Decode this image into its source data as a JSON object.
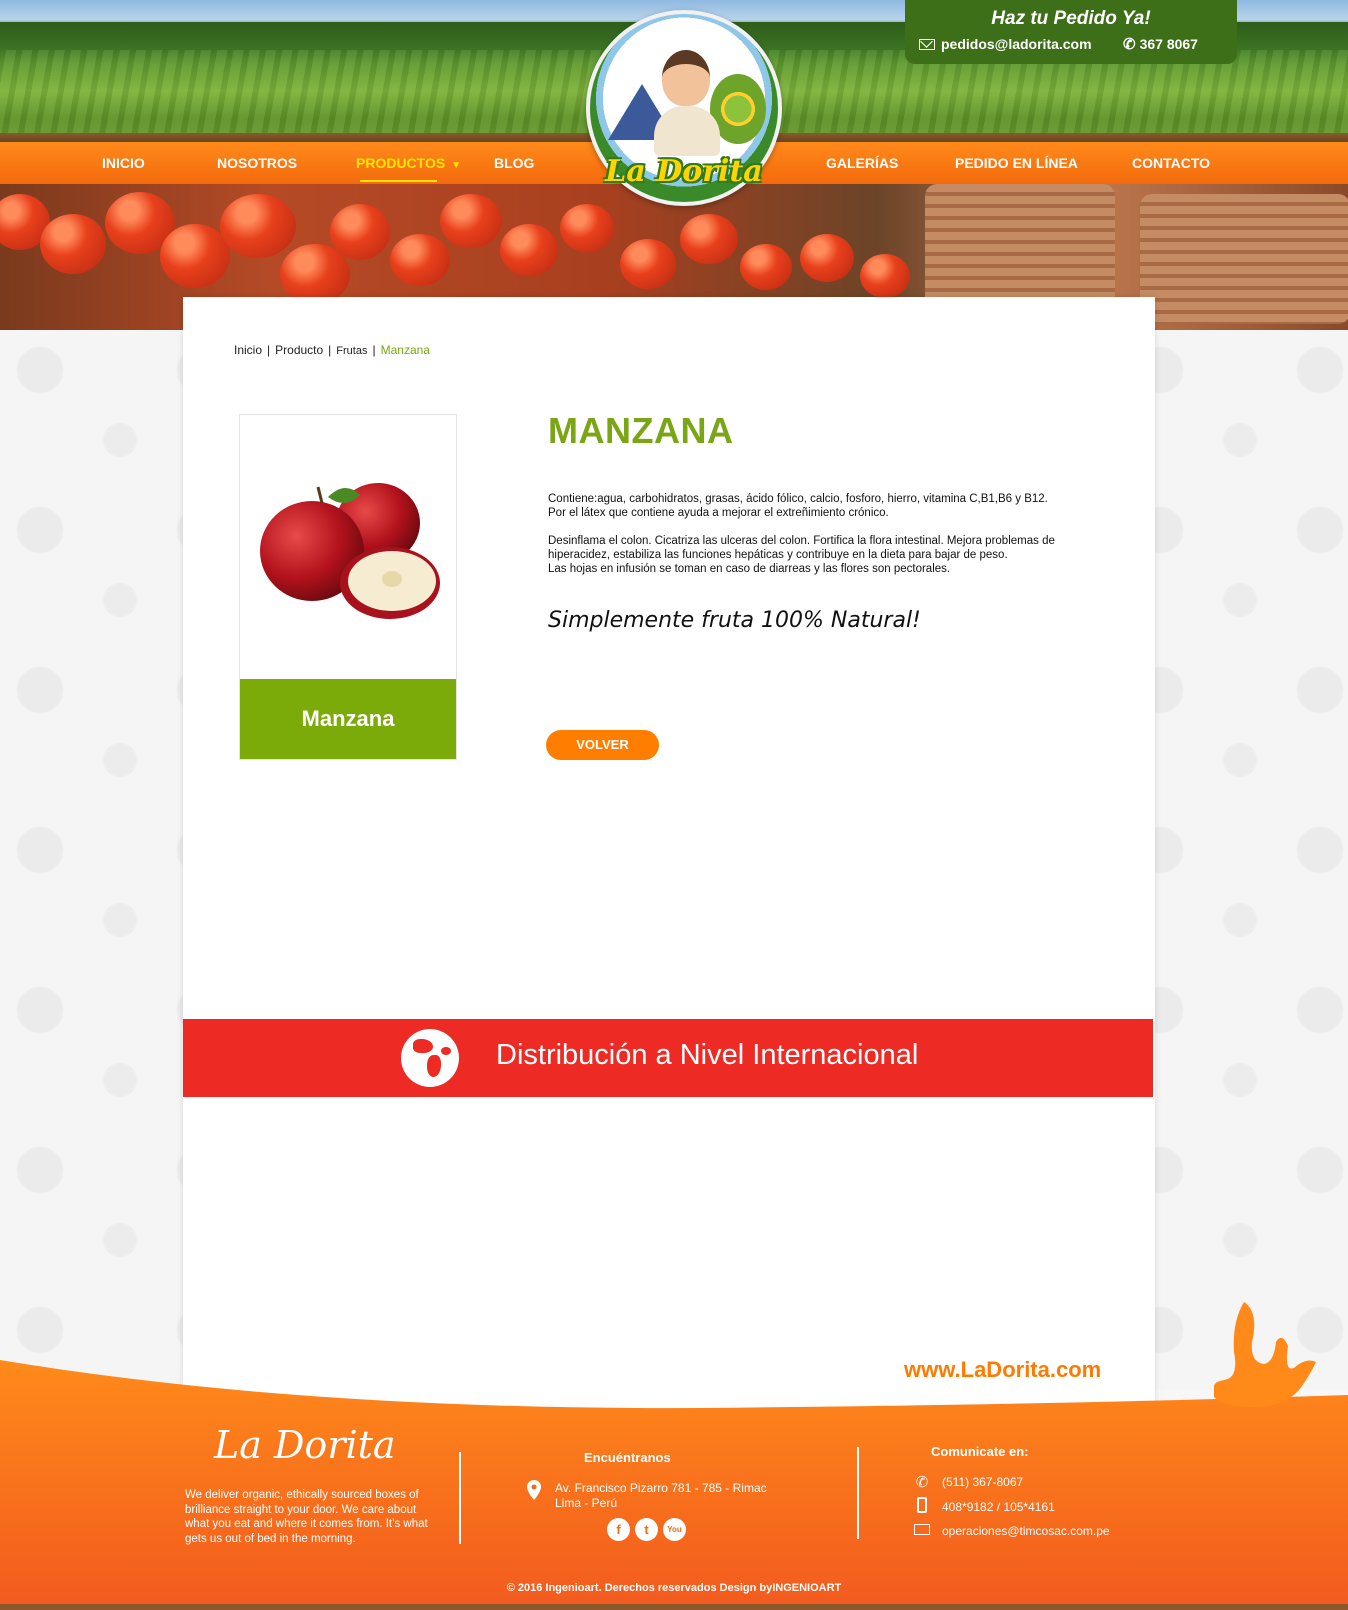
{
  "header": {
    "order_title": "Haz tu Pedido Ya!",
    "email": "pedidos@ladorita.com",
    "phone": "367 8067",
    "logo_text": "La Dorita"
  },
  "nav": {
    "items": [
      {
        "label": "INICIO"
      },
      {
        "label": "NOSOTROS"
      },
      {
        "label": "PRODUCTOS"
      },
      {
        "label": "BLOG"
      },
      {
        "label": "GALERÍAS"
      },
      {
        "label": "PEDIDO EN LÍNEA"
      },
      {
        "label": "CONTACTO"
      }
    ],
    "active": "PRODUCTOS"
  },
  "breadcrumb": {
    "items": [
      "Inicio",
      "Producto",
      "Frutas"
    ],
    "current": "Manzana"
  },
  "product": {
    "card_label": "Manzana",
    "title": "MANZANA",
    "paragraph1": "Contiene:agua, carbohidratos, grasas, ácido fólico, calcio, fosforo, hierro, vitamina C,B1,B6 y B12.",
    "paragraph2": "Por el látex que contiene ayuda a mejorar el extreñimiento crónico.",
    "paragraph3": "Desinflama el colon. Cicatriza las ulceras del colon. Fortifica la flora intestinal. Mejora problemas de hiperacidez, estabiliza las funciones hepáticas y contribuye en la dieta para bajar de peso.",
    "paragraph4": "Las hojas en infusión se toman en caso de diarreas  y las flores son pectorales.",
    "tagline": "Simplemente fruta 100% Natural!",
    "back_label": "VOLVER"
  },
  "distribution": {
    "text": "Distribución a Nivel Internacional"
  },
  "footer": {
    "site_url": "www.LaDorita.com",
    "brand": "La Dorita",
    "about": "We deliver organic, ethically sourced boxes of brilliance straight to your door. We care about what you eat and where it comes from. It’s what gets us out of bed in the morning.",
    "find_title": "Encuéntranos",
    "address_line1": "Av. Francisco Pizarro 781 - 785 - Rimac",
    "address_line2": "Lima - Perú",
    "socials": [
      "f",
      "t",
      "You"
    ],
    "contact_title": "Comunicate en:",
    "phone": "(511) 367-8067",
    "mobile": "408*9182 / 105*4161",
    "email": "operaciones@timcosac.com.pe",
    "copyright": "© 2016 Ingenioart. Derechos reservados Design byINGENIOART"
  },
  "colors": {
    "accent_green": "#7aab08",
    "accent_orange": "#ff7e00",
    "distribution_red": "#ee2a24"
  }
}
